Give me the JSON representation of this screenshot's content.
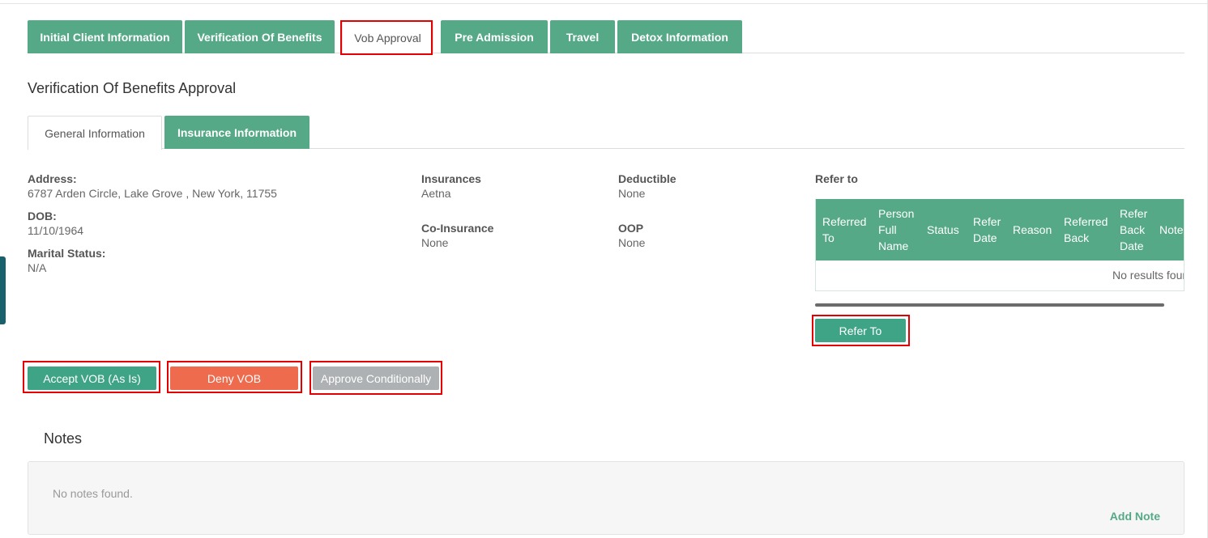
{
  "main_tabs": [
    {
      "label": "Initial Client Information"
    },
    {
      "label": "Verification Of Benefits"
    },
    {
      "label": "Vob Approval"
    },
    {
      "label": "Pre Admission"
    },
    {
      "label": "Travel"
    },
    {
      "label": "Detox Information"
    }
  ],
  "page_title": "Verification Of Benefits Approval",
  "sub_tabs": [
    {
      "label": "General Information"
    },
    {
      "label": "Insurance Information"
    }
  ],
  "general": {
    "address_label": "Address:",
    "address_value": "6787 Arden Circle, Lake Grove , New York, 11755",
    "dob_label": "DOB:",
    "dob_value": "11/10/1964",
    "marital_label": "Marital Status:",
    "marital_value": "N/A",
    "insurances_label": "Insurances",
    "insurances_value": "Aetna",
    "coinsurance_label": "Co-Insurance",
    "coinsurance_value": "None",
    "deductible_label": "Deductible",
    "deductible_value": "None",
    "oop_label": "OOP",
    "oop_value": "None"
  },
  "refer": {
    "title": "Refer to",
    "columns": [
      [
        "Referred",
        "To"
      ],
      [
        "Person",
        "Full",
        "Name"
      ],
      [
        "Status"
      ],
      [
        "Refer",
        "Date"
      ],
      [
        "Reason"
      ],
      [
        "Referred",
        "Back"
      ],
      [
        "Refer",
        "Back",
        "Date"
      ],
      [
        "Note"
      ]
    ],
    "no_results": "No results found",
    "button_label": "Refer To"
  },
  "actions": {
    "accept_label": "Accept VOB (As Is)",
    "deny_label": "Deny VOB",
    "approve_cond_label": "Approve Conditionally"
  },
  "notes": {
    "title": "Notes",
    "empty_text": "No notes found.",
    "add_label": "Add Note"
  },
  "colors": {
    "accent_green": "#55a987",
    "deny_orange": "#ee6b4d",
    "disabled_gray": "#adb1b3",
    "highlight_red": "#e40000"
  }
}
